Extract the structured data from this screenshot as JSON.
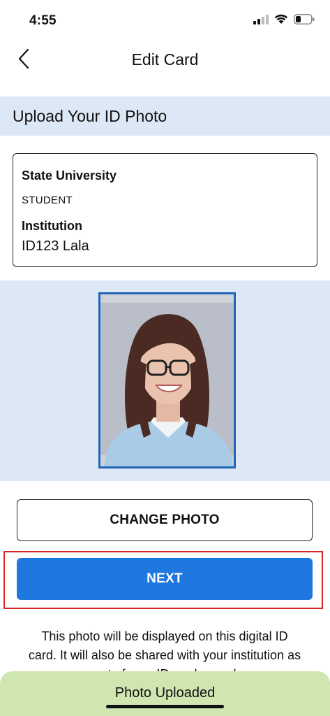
{
  "status_bar": {
    "time": "4:55",
    "icons": [
      "cellular-signal-icon",
      "wifi-icon",
      "battery-icon"
    ]
  },
  "nav": {
    "title": "Edit Card",
    "back_icon": "chevron-left-icon"
  },
  "section": {
    "title": "Upload Your ID Photo"
  },
  "card": {
    "university": "State University",
    "role": "STUDENT",
    "institution_label": "Institution",
    "id_value": "ID123 Lala"
  },
  "photo": {
    "icon": "id-photo-portrait"
  },
  "actions": {
    "change_photo_label": "CHANGE PHOTO",
    "next_label": "NEXT"
  },
  "info": {
    "text": "This photo will be displayed on this digital ID card. It will also be shared with your institution as part of your ID card record."
  },
  "toast": {
    "message": "Photo Uploaded"
  },
  "colors": {
    "primary": "#1f78e0",
    "section_bg": "#dce8f6",
    "toast_bg": "#cfe6b0",
    "highlight": "#d9262a",
    "photo_border": "#2166b8"
  }
}
